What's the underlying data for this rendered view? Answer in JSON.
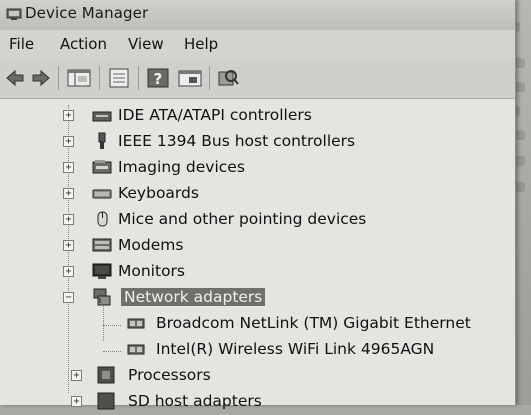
{
  "window": {
    "title": "Device Manager"
  },
  "menu": {
    "file": "File",
    "action": "Action",
    "view": "View",
    "help": "Help"
  },
  "toolbar": {
    "buttons": [
      "back-icon",
      "forward-icon",
      "show-hide-tree-icon",
      "properties-icon",
      "help-icon",
      "update-driver-icon",
      "scan-hardware-icon"
    ]
  },
  "tree": {
    "categories": [
      {
        "label": "IDE ATA/ATAPI controllers",
        "icon": "ide-controller-icon",
        "expanded": false
      },
      {
        "label": "IEEE 1394 Bus host controllers",
        "icon": "ieee1394-icon",
        "expanded": false
      },
      {
        "label": "Imaging devices",
        "icon": "imaging-device-icon",
        "expanded": false
      },
      {
        "label": "Keyboards",
        "icon": "keyboard-icon",
        "expanded": false
      },
      {
        "label": "Mice and other pointing devices",
        "icon": "mouse-icon",
        "expanded": false
      },
      {
        "label": "Modems",
        "icon": "modem-icon",
        "expanded": false
      },
      {
        "label": "Monitors",
        "icon": "monitor-icon",
        "expanded": false
      },
      {
        "label": "Network adapters",
        "icon": "network-adapter-icon",
        "expanded": true,
        "selected": true,
        "children": [
          {
            "label": "Broadcom NetLink (TM) Gigabit Ethernet",
            "icon": "network-card-icon"
          },
          {
            "label": "Intel(R) Wireless WiFi Link 4965AGN",
            "icon": "wireless-card-icon"
          }
        ]
      },
      {
        "label": "Processors",
        "icon": "processor-icon",
        "expanded": false
      },
      {
        "label": "SD host adapters",
        "icon": "sd-host-icon",
        "expanded": false
      }
    ]
  },
  "colors": {
    "selection": "#6f6f6c",
    "window_bg": "#e4e4e1"
  }
}
